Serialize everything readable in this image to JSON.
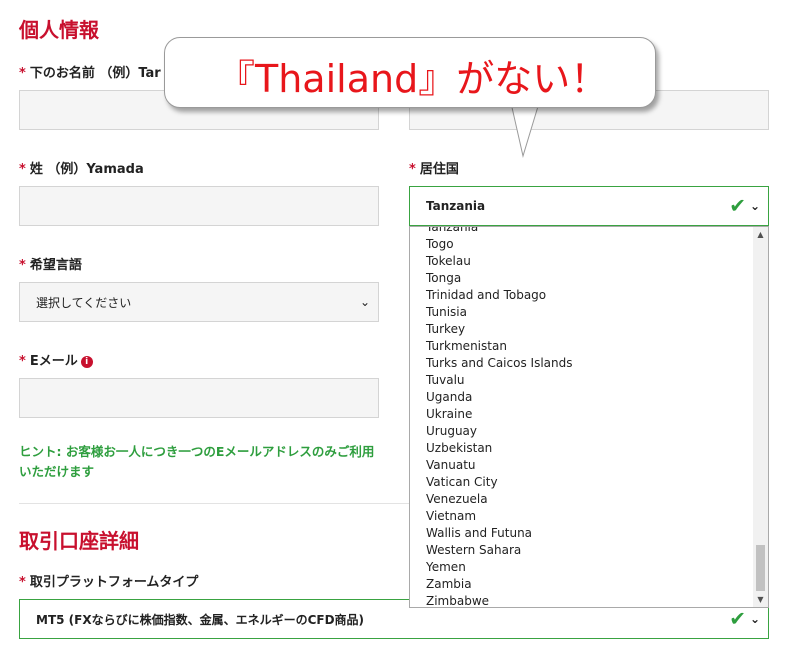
{
  "personal": {
    "section_title": "個人情報",
    "first_name_label": "下のお名前 （例）Tar",
    "last_name_label": "姓 （例）Yamada",
    "country_label": "居住国",
    "country_value": "Tanzania",
    "language_label": "希望言語",
    "language_value": "選択してください",
    "email_label": "Eメール",
    "hint": "ヒント: お客様お一人につき一つのEメールアドレスのみご利用いただけます"
  },
  "dropdown": {
    "partial_top": "Tanzania",
    "options": [
      "Togo",
      "Tokelau",
      "Tonga",
      "Trinidad and Tobago",
      "Tunisia",
      "Turkey",
      "Turkmenistan",
      "Turks and Caicos Islands",
      "Tuvalu",
      "Uganda",
      "Ukraine",
      "Uruguay",
      "Uzbekistan",
      "Vanuatu",
      "Vatican City",
      "Venezuela",
      "Vietnam",
      "Wallis and Futuna",
      "Western Sahara",
      "Yemen",
      "Zambia",
      "Zimbabwe"
    ]
  },
  "account": {
    "section_title": "取引口座詳細",
    "platform_label": "取引プラットフォームタイプ",
    "platform_value": "MT5 (FXならびに株価指数、金属、エネルギーのCFD商品)"
  },
  "callout": {
    "text": "『Thailand』がない！"
  },
  "required_mark": "*",
  "colors": {
    "accent_red": "#c8102e",
    "valid_green": "#2e9e3e",
    "callout_red": "#e8161b"
  }
}
